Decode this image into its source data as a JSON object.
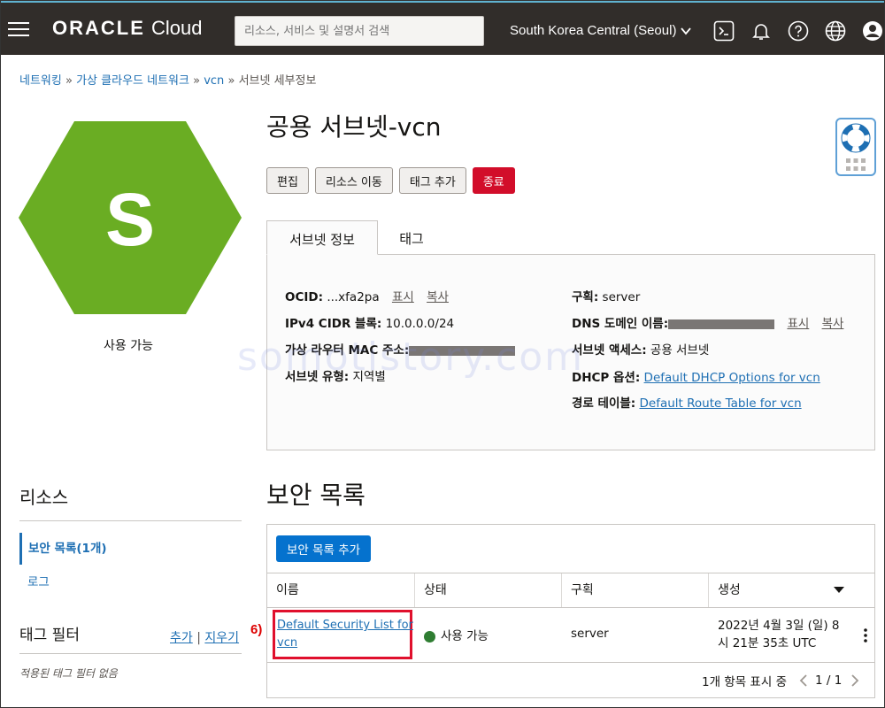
{
  "header": {
    "brand_bold": "ORACLE",
    "brand_light": "Cloud",
    "search_placeholder": "리소스, 서비스 및 설명서 검색",
    "region": "South Korea Central (Seoul)"
  },
  "breadcrumb": {
    "items": [
      "네트워킹",
      "가상 클라우드 네트워크",
      "vcn"
    ],
    "current": "서브넷 세부정보",
    "separator": "»"
  },
  "resource_icon": {
    "letter": "S",
    "color": "#6aad23",
    "status": "사용 가능"
  },
  "page": {
    "title": "공용 서브넷-vcn",
    "actions": {
      "edit": "편집",
      "move": "리소스 이동",
      "add_tag": "태그 추가",
      "terminate": "종료"
    }
  },
  "tabs": {
    "info": "서브넷 정보",
    "tags": "태그"
  },
  "details": {
    "ocid_label": "OCID:",
    "ocid_value": "...xfa2pa",
    "show": "표시",
    "copy": "복사",
    "cidr_label": "IPv4 CIDR 블록:",
    "cidr_value": "10.0.0.0/24",
    "mac_label": "가상 라우터 MAC 주소:",
    "type_label": "서브넷 유형:",
    "type_value": "지역별",
    "compartment_label": "구획:",
    "compartment_value": "server",
    "dns_label": "DNS 도메인 이름:",
    "access_label": "서브넷 액세스:",
    "access_value": "공용 서브넷",
    "dhcp_label": "DHCP 옵션:",
    "dhcp_value": "Default DHCP Options for vcn",
    "route_label": "경로 테이블:",
    "route_value": "Default Route Table for vcn"
  },
  "watermark": "somotistory.com",
  "resources": {
    "title": "리소스",
    "items": [
      "보안 목록(1개)",
      "로그"
    ]
  },
  "tag_filter": {
    "title": "태그 필터",
    "add": "추가",
    "sep": "|",
    "clear": "지우기",
    "empty": "적용된 태그 필터 없음"
  },
  "security": {
    "title": "보안 목록",
    "add_button": "보안 목록 추가",
    "columns": [
      "이름",
      "상태",
      "구획",
      "생성"
    ],
    "row": {
      "name_line1": "Default Security List for",
      "name_line2": "vcn",
      "state": "사용 가능",
      "compartment": "server",
      "created_line1": "2022년 4월 3일 (일) 8",
      "created_line2": "시 21분 35초 UTC"
    },
    "step_label": "6)",
    "footer": "1개 항목 표시 중",
    "page": "1 / 1"
  }
}
